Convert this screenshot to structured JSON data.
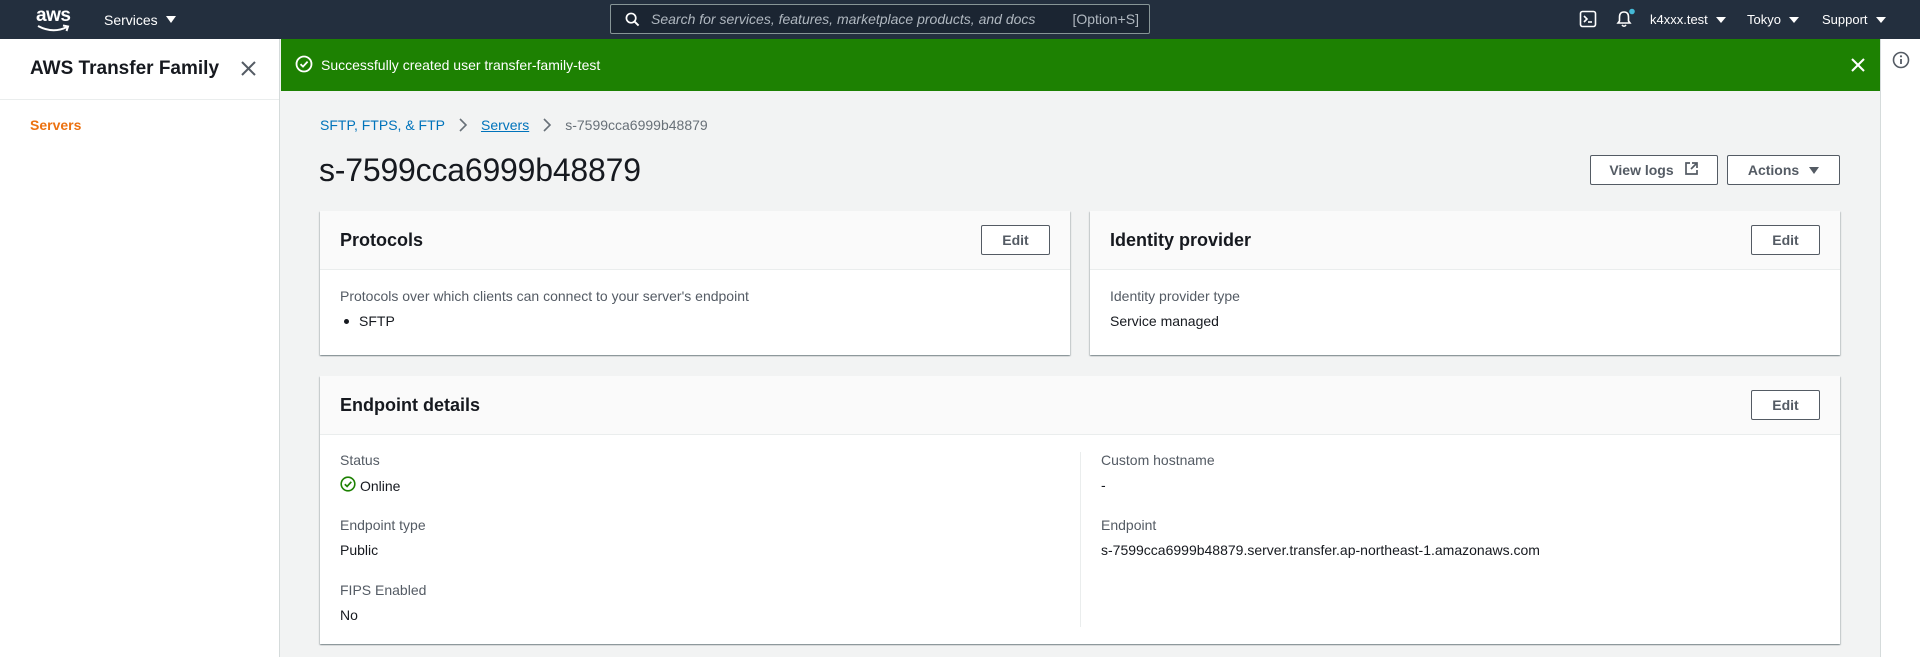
{
  "topnav": {
    "logo_text": "aws",
    "services_label": "Services",
    "search_placeholder": "Search for services, features, marketplace products, and docs",
    "search_shortcut": "[Option+S]",
    "account": "k4xxx.test",
    "region": "Tokyo",
    "support": "Support"
  },
  "sidenav": {
    "title": "AWS Transfer Family",
    "items": [
      {
        "label": "Servers"
      }
    ]
  },
  "flash": {
    "message": "Successfully created user transfer-family-test"
  },
  "breadcrumb": {
    "items": [
      "SFTP, FTPS, & FTP",
      "Servers"
    ],
    "current": "s-7599cca6999b48879"
  },
  "page": {
    "title": "s-7599cca6999b48879",
    "view_logs": "View logs",
    "actions": "Actions"
  },
  "protocols": {
    "title": "Protocols",
    "edit": "Edit",
    "label": "Protocols over which clients can connect to your server's endpoint",
    "values": [
      "SFTP"
    ]
  },
  "identity": {
    "title": "Identity provider",
    "edit": "Edit",
    "type_label": "Identity provider type",
    "type_value": "Service managed"
  },
  "endpoint": {
    "title": "Endpoint details",
    "edit": "Edit",
    "status_label": "Status",
    "status_value": "Online",
    "type_label": "Endpoint type",
    "type_value": "Public",
    "fips_label": "FIPS Enabled",
    "fips_value": "No",
    "hostname_label": "Custom hostname",
    "hostname_value": "-",
    "endpoint_label": "Endpoint",
    "endpoint_value": "s-7599cca6999b48879.server.transfer.ap-northeast-1.amazonaws.com"
  },
  "colors": {
    "nav_bg": "#232f3e",
    "success": "#1d8102",
    "accent_orange": "#ec7211",
    "link_blue": "#0073bb"
  }
}
